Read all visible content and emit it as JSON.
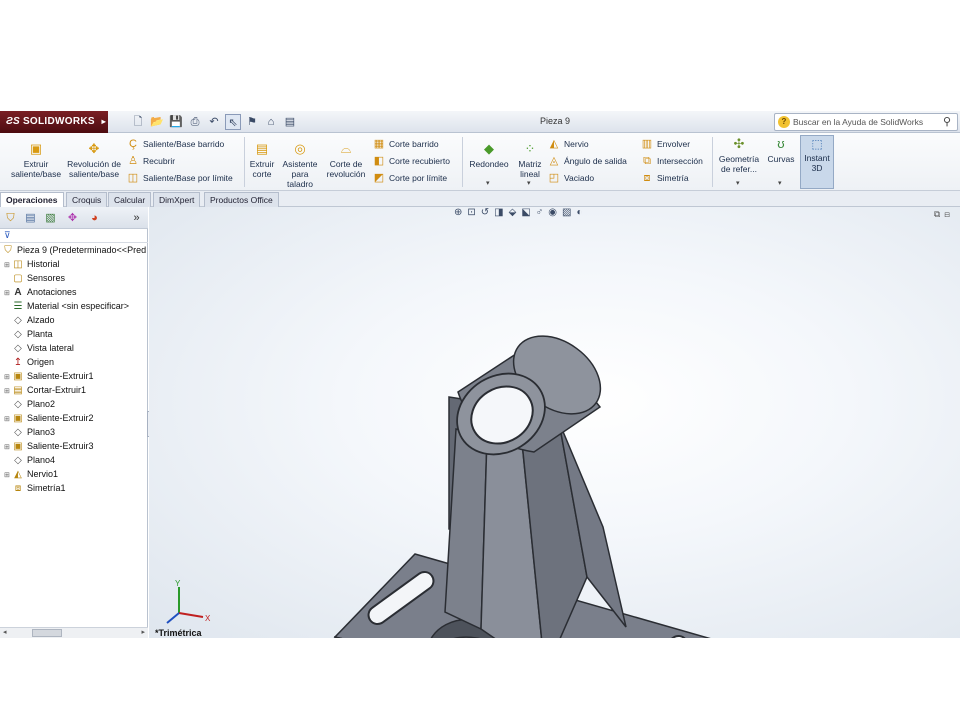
{
  "app": {
    "brand": "SOLIDWORKS",
    "doc_title": "Pieza 9",
    "help_placeholder": "Buscar en la Ayuda de SolidWorks"
  },
  "ribbon": {
    "extruir_saliente": "Extruir saliente/base",
    "revolucion_saliente": "Revolución de saliente/base",
    "saliente_barrido": "Saliente/Base barrido",
    "recubrir": "Recubrir",
    "saliente_limite": "Saliente/Base por límite",
    "extruir_corte": "Extruir corte",
    "asistente_taladro": "Asistente para taladro",
    "corte_revolucion": "Corte de revolución",
    "corte_barrido": "Corte barrido",
    "corte_recubierto": "Corte recubierto",
    "corte_limite": "Corte por límite",
    "redondeo": "Redondeo",
    "matriz_lineal": "Matriz lineal",
    "nervio": "Nervio",
    "angulo_salida": "Ángulo de salida",
    "vaciado": "Vaciado",
    "envolver": "Envolver",
    "interseccion": "Intersección",
    "simetria": "Simetría",
    "geometria_referencia": "Geometría de refer...",
    "curvas": "Curvas",
    "instant3d": "Instant 3D"
  },
  "tabs": [
    "Operaciones",
    "Croquis",
    "Calcular",
    "DimXpert",
    "Productos Office"
  ],
  "tree": {
    "root": "Pieza 9  (Predeterminado<<Pred",
    "items": [
      "Historial",
      "Sensores",
      "Anotaciones",
      "Material <sin especificar>",
      "Alzado",
      "Planta",
      "Vista lateral",
      "Origen",
      "Saliente-Extruir1",
      "Cortar-Extruir1",
      "Plano2",
      "Saliente-Extruir2",
      "Plano3",
      "Saliente-Extruir3",
      "Plano4",
      "Nervio1",
      "Simetría1"
    ]
  },
  "viewport": {
    "view_label": "*Trimétrica",
    "axis_x": "X",
    "axis_y": "Y"
  },
  "colors": {
    "brand": "#6b1a1f",
    "model": "#6f7480",
    "accent": "#d89a12"
  }
}
